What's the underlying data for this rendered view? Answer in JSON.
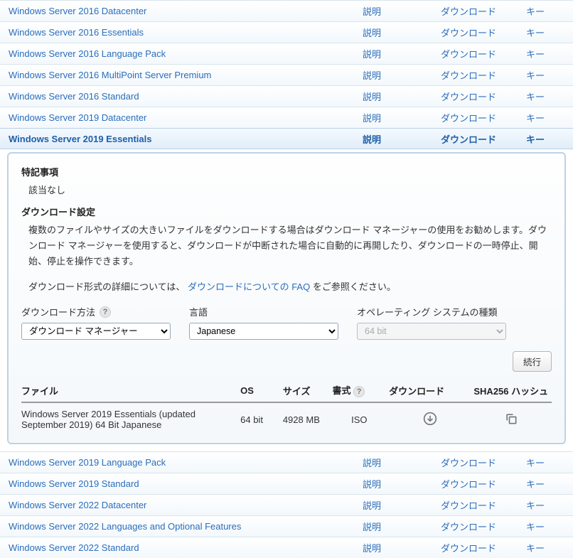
{
  "columns": {
    "desc": "説明",
    "download": "ダウンロード",
    "key": "キー"
  },
  "products_top": [
    {
      "name": "Windows Server 2016 Datacenter"
    },
    {
      "name": "Windows Server 2016 Essentials"
    },
    {
      "name": "Windows Server 2016 Language Pack"
    },
    {
      "name": "Windows Server 2016 MultiPoint Server Premium"
    },
    {
      "name": "Windows Server 2016 Standard"
    },
    {
      "name": "Windows Server 2019 Datacenter"
    }
  ],
  "selected": {
    "name": "Windows Server 2019 Essentials"
  },
  "panel": {
    "notes_title": "特記事項",
    "notes_body": "該当なし",
    "dl_settings_title": "ダウンロード設定",
    "dl_settings_body": "複数のファイルやサイズの大きいファイルをダウンロードする場合はダウンロード マネージャーの使用をお勧めします。ダウンロード マネージャーを使用すると、ダウンロードが中断された場合に自動的に再開したり、ダウンロードの一時停止、開始、停止を操作できます。",
    "faq_prefix": "ダウンロード形式の詳細については、",
    "faq_link": "ダウンロードについての FAQ",
    "faq_suffix": " をご参照ください。",
    "labels": {
      "method": "ダウンロード方法",
      "lang": "言語",
      "os": "オペレーティング システムの種類"
    },
    "values": {
      "method": "ダウンロード マネージャー",
      "lang": "Japanese",
      "os": "64 bit"
    },
    "continue_btn": "続行",
    "table": {
      "headers": {
        "file": "ファイル",
        "os": "OS",
        "size": "サイズ",
        "format": "書式",
        "download": "ダウンロード",
        "hash": "SHA256 ハッシュ"
      },
      "row": {
        "file": "Windows Server 2019 Essentials (updated September 2019) 64 Bit Japanese",
        "os": "64 bit",
        "size": "4928 MB",
        "format": "ISO"
      }
    }
  },
  "products_bottom": [
    {
      "name": "Windows Server 2019 Language Pack"
    },
    {
      "name": "Windows Server 2019 Standard"
    },
    {
      "name": "Windows Server 2022 Datacenter"
    },
    {
      "name": "Windows Server 2022 Languages and Optional Features"
    },
    {
      "name": "Windows Server 2022 Standard"
    }
  ]
}
